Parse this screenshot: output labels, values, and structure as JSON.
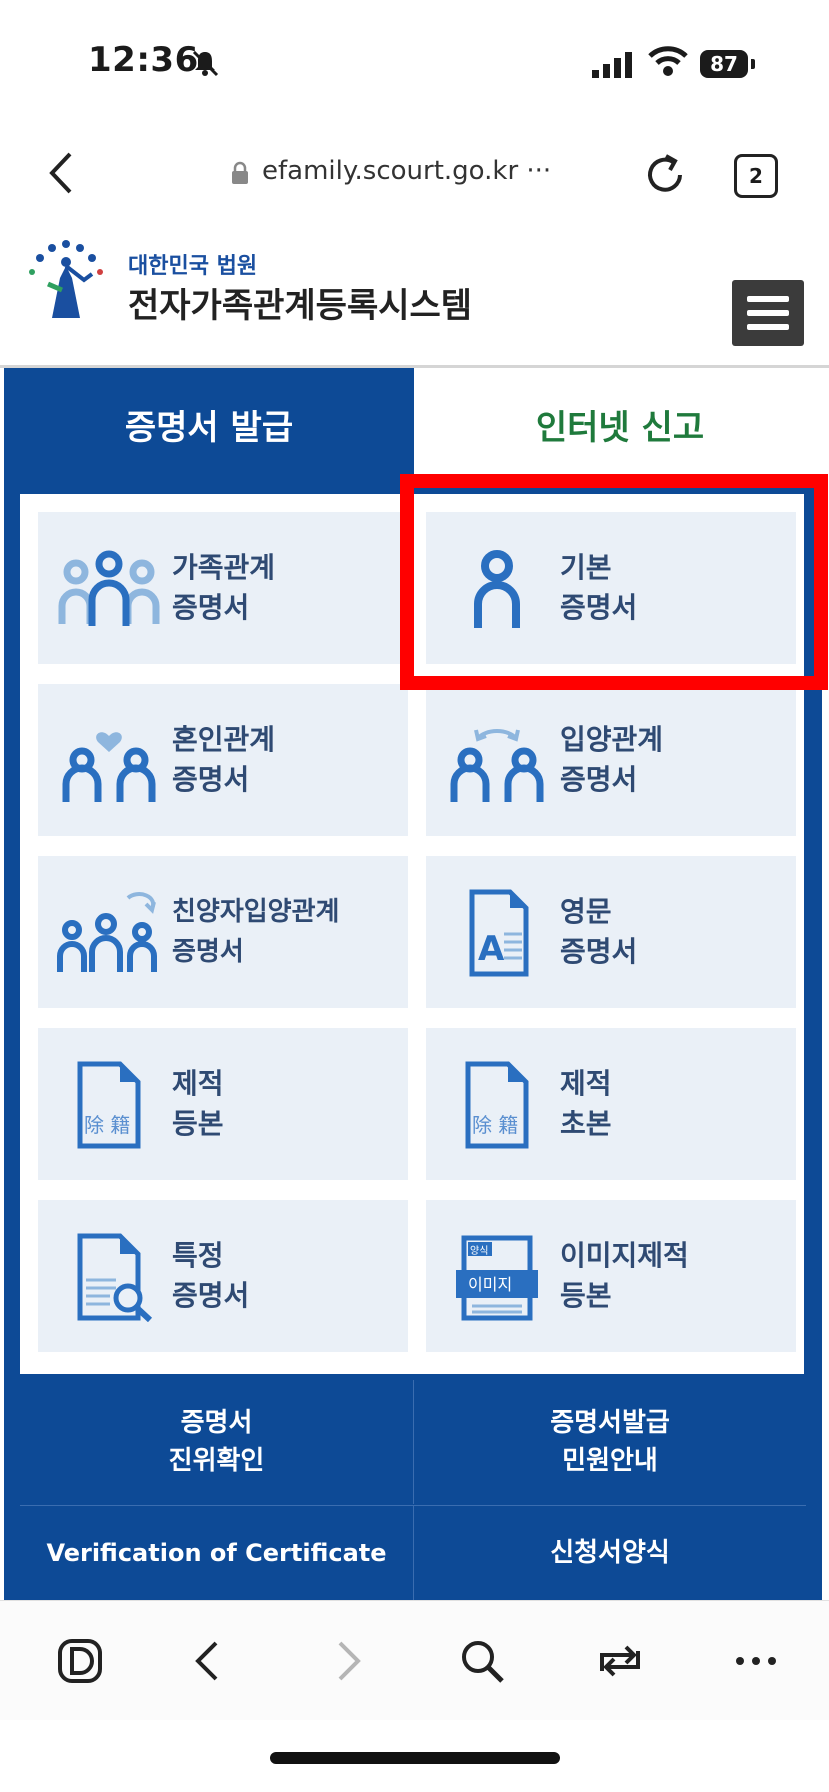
{
  "status": {
    "time": "12:36",
    "battery": "87"
  },
  "browser": {
    "url": "efamily.scourt.go.kr ···",
    "tab_count": "2"
  },
  "site": {
    "subtitle": "대한민국 법원",
    "title": "전자가족관계등록시스템"
  },
  "tabs": [
    {
      "label": "증명서 발급",
      "active": true
    },
    {
      "label": "인터넷 신고",
      "active": false
    }
  ],
  "cards": [
    {
      "line1": "가족관계",
      "line2": "증명서",
      "icon": "family-icon"
    },
    {
      "line1": "기본",
      "line2": "증명서",
      "icon": "person-icon"
    },
    {
      "line1": "혼인관계",
      "line2": "증명서",
      "icon": "couple-heart-icon"
    },
    {
      "line1": "입양관계",
      "line2": "증명서",
      "icon": "adoption-icon"
    },
    {
      "line1": "친양자입양관계",
      "line2": "증명서",
      "icon": "family-arrow-icon"
    },
    {
      "line1": "영문",
      "line2": "증명서",
      "icon": "english-document-icon"
    },
    {
      "line1": "제적",
      "line2": "등본",
      "icon": "removed-register-document-icon",
      "doc_text": "除 籍"
    },
    {
      "line1": "제적",
      "line2": "초본",
      "icon": "removed-register-document-icon",
      "doc_text": "除 籍"
    },
    {
      "line1": "특정",
      "line2": "증명서",
      "icon": "document-search-icon"
    },
    {
      "line1": "이미지제적",
      "line2": "등본",
      "icon": "image-document-icon",
      "doc_tag_top": "양식",
      "doc_tag": "이미지"
    }
  ],
  "bottom_links": [
    {
      "line1": "증명서",
      "line2": "진위확인"
    },
    {
      "line1": "증명서발급",
      "line2": "민원안내"
    },
    {
      "line1": "Verification of Certificate"
    },
    {
      "line1": "신청서양식"
    }
  ],
  "colors": {
    "primary": "#0d4a96",
    "card_bg": "#eaf0f7",
    "icon_blue": "#2a6fc0",
    "highlight": "#ff0000",
    "report_tab": "#1f7a3c"
  }
}
